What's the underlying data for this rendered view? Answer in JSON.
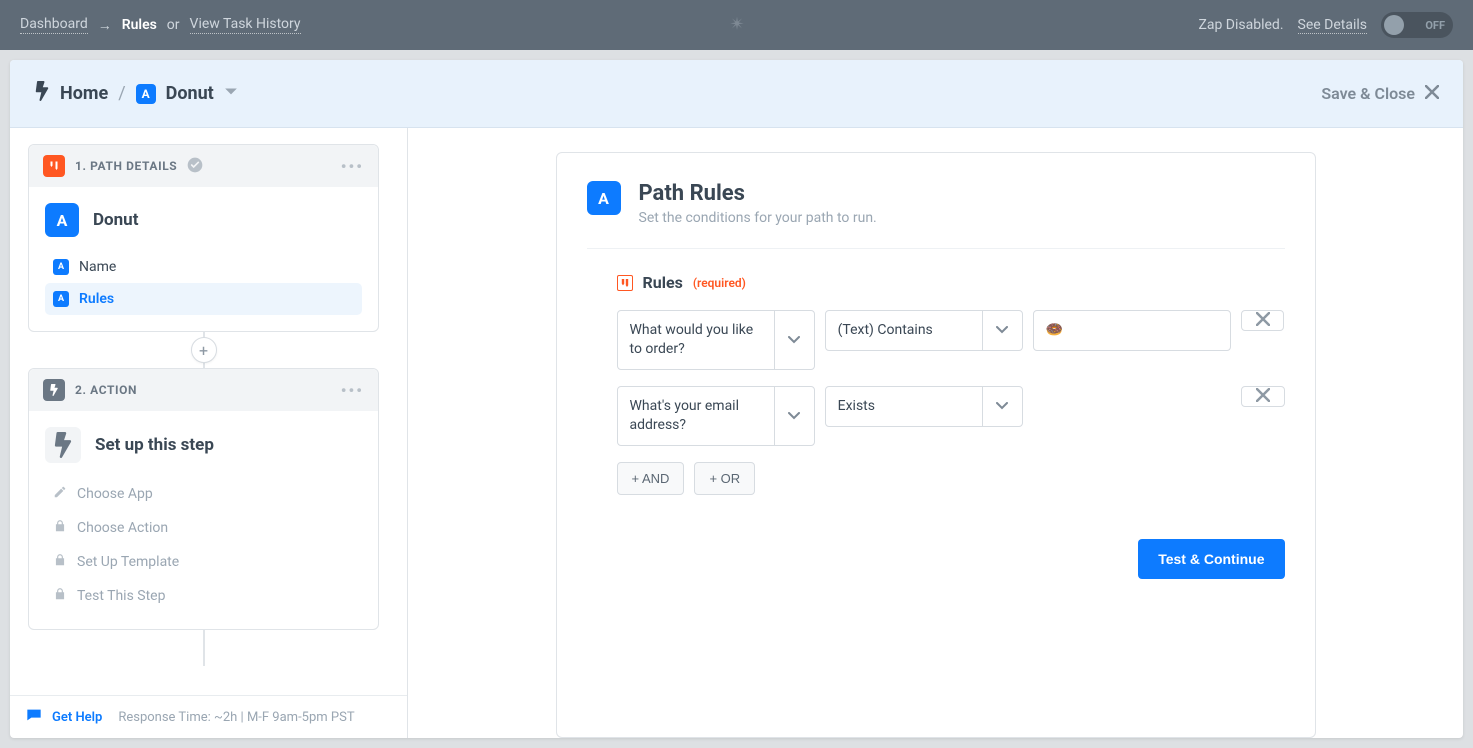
{
  "topbar": {
    "dashboard": "Dashboard",
    "arrow": "→",
    "rules": "Rules",
    "or": "or",
    "task_history": "View Task History",
    "disabled_label": "Zap Disabled.",
    "see_details": "See Details",
    "toggle_label": "OFF"
  },
  "header": {
    "home": "Home",
    "slash": "/",
    "letter": "A",
    "path_name": "Donut",
    "save_close": "Save & Close"
  },
  "steps": {
    "path_details": {
      "number_label": "1. PATH DETAILS",
      "title_letter": "A",
      "title": "Donut",
      "items": [
        {
          "letter": "A",
          "label": "Name",
          "active": false
        },
        {
          "letter": "A",
          "label": "Rules",
          "active": true
        }
      ]
    },
    "action": {
      "number_label": "2. ACTION",
      "title": "Set up this step",
      "items": [
        {
          "icon": "pencil",
          "label": "Choose App"
        },
        {
          "icon": "lock",
          "label": "Choose Action"
        },
        {
          "icon": "lock",
          "label": "Set Up Template"
        },
        {
          "icon": "lock",
          "label": "Test This Step"
        }
      ]
    },
    "add_plus": "+"
  },
  "helpbar": {
    "get_help": "Get Help",
    "response": "Response Time: ~2h | M-F 9am-5pm PST"
  },
  "content": {
    "badge_letter": "A",
    "title": "Path Rules",
    "subtitle": "Set the conditions for your path to run.",
    "section_label": "Rules",
    "required": "(required)",
    "rules": [
      {
        "field": "What would you like to order?",
        "op": "(Text) Contains",
        "value": "🍩"
      },
      {
        "field": "What's your email address?",
        "op": "Exists",
        "value": ""
      }
    ],
    "and_btn": "+ AND",
    "or_btn": "+ OR",
    "cta": "Test & Continue"
  }
}
